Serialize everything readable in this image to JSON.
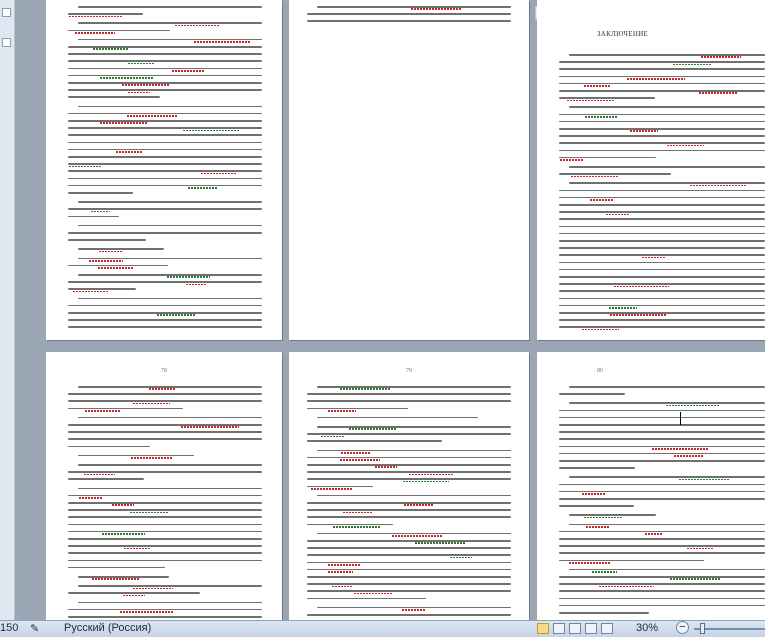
{
  "status_bar": {
    "position_text": "150",
    "language_icon": "spellcheck-book-icon",
    "language": "Русский (Россия)",
    "zoom_label": "30%",
    "zoom_out_symbol": "−",
    "zoom_level": 30
  },
  "ruler": {
    "numbers": [
      "2",
      "1"
    ]
  },
  "pages": {
    "top_right": {
      "heading": "ЗАКЛЮЧЕНИЕ"
    },
    "bottom_left": {
      "page_number": "78"
    },
    "bottom_middle": {
      "page_number": "79"
    },
    "bottom_right": {
      "page_number": "80"
    }
  },
  "colors": {
    "workspace": "#9aa6b4",
    "spell_error": "#c62828",
    "grammar_error": "#2e7d32"
  }
}
